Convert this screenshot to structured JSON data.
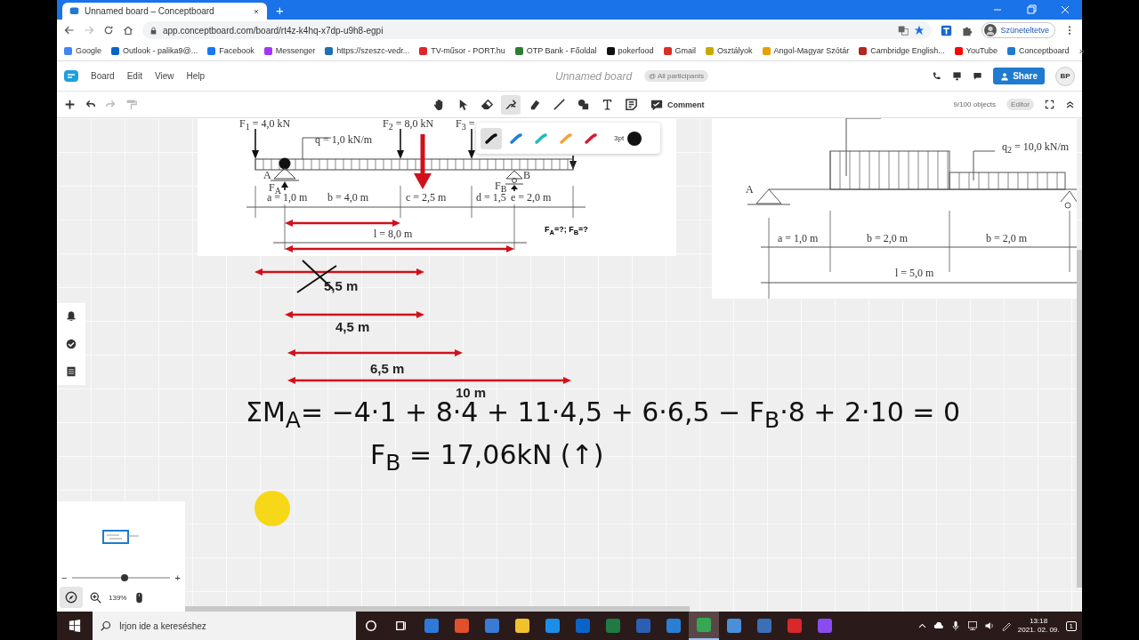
{
  "browser": {
    "tab_title": "Unnamed board – Conceptboard",
    "new_tab": "+",
    "url": "app.conceptboard.com/board/rt4z-k4hq-x7dp-u9h8-egpi",
    "profile": "Szüneteltetve",
    "bookmarks": [
      {
        "label": "Google",
        "color": "#4285f4"
      },
      {
        "label": "Outlook - palika9@...",
        "color": "#0a64c8"
      },
      {
        "label": "Facebook",
        "color": "#1877f2"
      },
      {
        "label": "Messenger",
        "color": "#a334fa"
      },
      {
        "label": "https://szeszc-vedr...",
        "color": "#1f6fb2"
      },
      {
        "label": "TV-műsor - PORT.hu",
        "color": "#e0242b"
      },
      {
        "label": "OTP Bank - Főoldal",
        "color": "#2e7d32"
      },
      {
        "label": "pokerfood",
        "color": "#111111"
      },
      {
        "label": "Gmail",
        "color": "#d93025"
      },
      {
        "label": "Osztályok",
        "color": "#c9a800"
      },
      {
        "label": "Angol-Magyar Szótár",
        "color": "#e6a100"
      },
      {
        "label": "Cambridge English...",
        "color": "#b3261e"
      },
      {
        "label": "YouTube",
        "color": "#ff0000"
      },
      {
        "label": "Conceptboard",
        "color": "#1f7ad0"
      }
    ],
    "more": "»"
  },
  "app": {
    "menu": [
      "Board",
      "Edit",
      "View",
      "Help"
    ],
    "board_title": "Unnamed board",
    "participants": "@ All participants",
    "share": "Share",
    "avatar": "BP"
  },
  "toolbar": {
    "tools": [
      {
        "kind": "hand",
        "selected": false
      },
      {
        "kind": "pointer",
        "selected": false
      },
      {
        "kind": "eraser",
        "selected": false
      },
      {
        "kind": "pen",
        "selected": true
      },
      {
        "kind": "marker",
        "selected": false
      },
      {
        "kind": "line",
        "selected": false
      },
      {
        "kind": "shapes",
        "selected": false
      },
      {
        "kind": "text",
        "selected": false
      },
      {
        "kind": "note",
        "selected": false
      }
    ],
    "comment": "Comment",
    "objects": "9/100 objects",
    "mode": "Editor"
  },
  "pen_palette": {
    "pens": [
      {
        "color": "#111111",
        "selected": true
      },
      {
        "color": "#1e7fd6",
        "selected": false
      },
      {
        "color": "#22b8c4",
        "selected": false
      },
      {
        "color": "#f2a23a",
        "selected": false
      },
      {
        "color": "#d81b2c",
        "selected": false
      }
    ],
    "size": "3pt"
  },
  "diagram_left": {
    "labels": [
      "F$_{1}$ = 4,0 kN",
      "q = 1,0 kN/m",
      "F$_{2}$ = 8,0 kN",
      "F$_{3}$ =",
      "A",
      "F$_{A}$",
      "B",
      "F$_{B}$",
      "a = 1,0 m",
      "b = 4,0 m",
      "c = 2,5 m",
      "d = 1,5",
      "e = 2,0 m",
      "l = 8,0 m"
    ],
    "question": "F$_{A}$=?; F$_{B}$=?"
  },
  "diagram_right": {
    "labels": [
      "q$_{2}$ = 10,0 kN/m",
      "A",
      "a = 1,0 m",
      "b = 2,0 m",
      "b = 2,0 m",
      "l = 5,0 m"
    ]
  },
  "annotations": {
    "lengths": [
      "5,5 m",
      "4,5 m",
      "6,5 m",
      "10 m"
    ]
  },
  "handwriting": [
    "ΣM$_{A}$= −4·1 + 8·4 + 11·4,5 + 6·6,5 − F$_{B}$·8 + 2·10 = 0",
    "F$_{B}$ = 17,06kN (↑)"
  ],
  "minimap": {
    "minus": "−",
    "plus": "+",
    "level": 0.54,
    "zoom": "139%"
  },
  "taskbar": {
    "search_placeholder": "Írjon ide a kereséshez",
    "apps": [
      {
        "color": "#2f7ad8",
        "selected": false
      },
      {
        "color": "#e0502a",
        "selected": false
      },
      {
        "color": "#3a7bd5",
        "selected": false
      },
      {
        "color": "#f2c12e",
        "selected": false
      },
      {
        "color": "#1b8fe8",
        "selected": false
      },
      {
        "color": "#0a64c8",
        "selected": false
      },
      {
        "color": "#1f7a44",
        "selected": false
      },
      {
        "color": "#2b5fb4",
        "selected": false
      },
      {
        "color": "#2a7fd4",
        "selected": false
      },
      {
        "color": "#34a853",
        "selected": true
      },
      {
        "color": "#4a8fd8",
        "selected": false
      },
      {
        "color": "#3b6fb8",
        "selected": false
      },
      {
        "color": "#d8282a",
        "selected": false
      },
      {
        "color": "#8a4bf0",
        "selected": false
      }
    ],
    "time": "13:18",
    "date": "2021. 02. 09.",
    "notifications": "1"
  }
}
